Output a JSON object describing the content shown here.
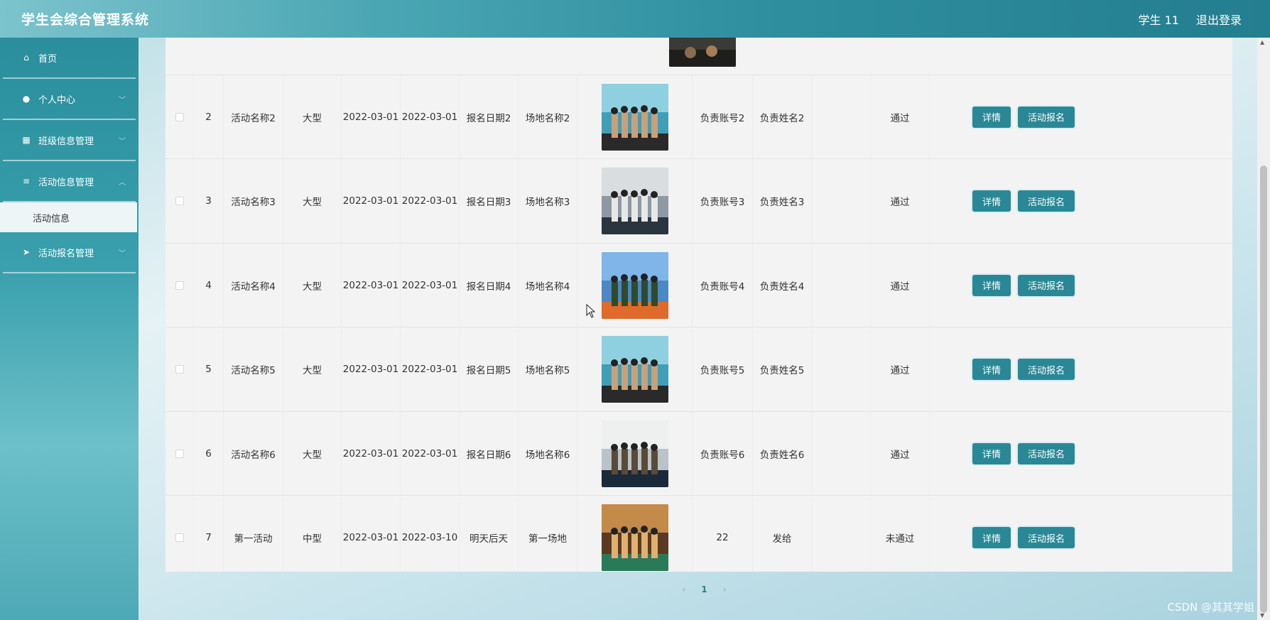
{
  "app": {
    "title": "学生会综合管理系统",
    "user": "学生 11",
    "logout": "退出登录"
  },
  "sidebar": {
    "items": [
      {
        "label": "首页",
        "icon": "home-icon"
      },
      {
        "label": "个人中心",
        "icon": "user-icon"
      },
      {
        "label": "班级信息管理",
        "icon": "grid-icon"
      },
      {
        "label": "活动信息管理",
        "icon": "sliders-icon"
      },
      {
        "label": "活动报名管理",
        "icon": "send-icon"
      }
    ],
    "submenu_active": "活动信息"
  },
  "table": {
    "rows": [
      {
        "no": "2",
        "name": "活动名称2",
        "type": "大型",
        "start": "2022-03-01",
        "end": "2022-03-01",
        "reg": "报名日期2",
        "venue": "场地名称2",
        "acct": "负责账号2",
        "person": "负责姓名2",
        "status": "通过"
      },
      {
        "no": "3",
        "name": "活动名称3",
        "type": "大型",
        "start": "2022-03-01",
        "end": "2022-03-01",
        "reg": "报名日期3",
        "venue": "场地名称3",
        "acct": "负责账号3",
        "person": "负责姓名3",
        "status": "通过"
      },
      {
        "no": "4",
        "name": "活动名称4",
        "type": "大型",
        "start": "2022-03-01",
        "end": "2022-03-01",
        "reg": "报名日期4",
        "venue": "场地名称4",
        "acct": "负责账号4",
        "person": "负责姓名4",
        "status": "通过"
      },
      {
        "no": "5",
        "name": "活动名称5",
        "type": "大型",
        "start": "2022-03-01",
        "end": "2022-03-01",
        "reg": "报名日期5",
        "venue": "场地名称5",
        "acct": "负责账号5",
        "person": "负责姓名5",
        "status": "通过"
      },
      {
        "no": "6",
        "name": "活动名称6",
        "type": "大型",
        "start": "2022-03-01",
        "end": "2022-03-01",
        "reg": "报名日期6",
        "venue": "场地名称6",
        "acct": "负责账号6",
        "person": "负责姓名6",
        "status": "通过"
      },
      {
        "no": "7",
        "name": "第一活动",
        "type": "中型",
        "start": "2022-03-01",
        "end": "2022-03-10",
        "reg": "明天后天",
        "venue": "第一场地",
        "acct": "22",
        "person": "发给",
        "status": "未通过"
      }
    ],
    "detail_label": "详情",
    "signup_label": "活动报名"
  },
  "pagination": {
    "prev": "‹",
    "current": "1",
    "next": "›"
  },
  "watermark": "CSDN @其其学姐",
  "colors": {
    "accent": "#2a8896",
    "header_start": "#7cc3cd",
    "header_end": "#237e8f",
    "page_active": "#1d8a7c"
  }
}
